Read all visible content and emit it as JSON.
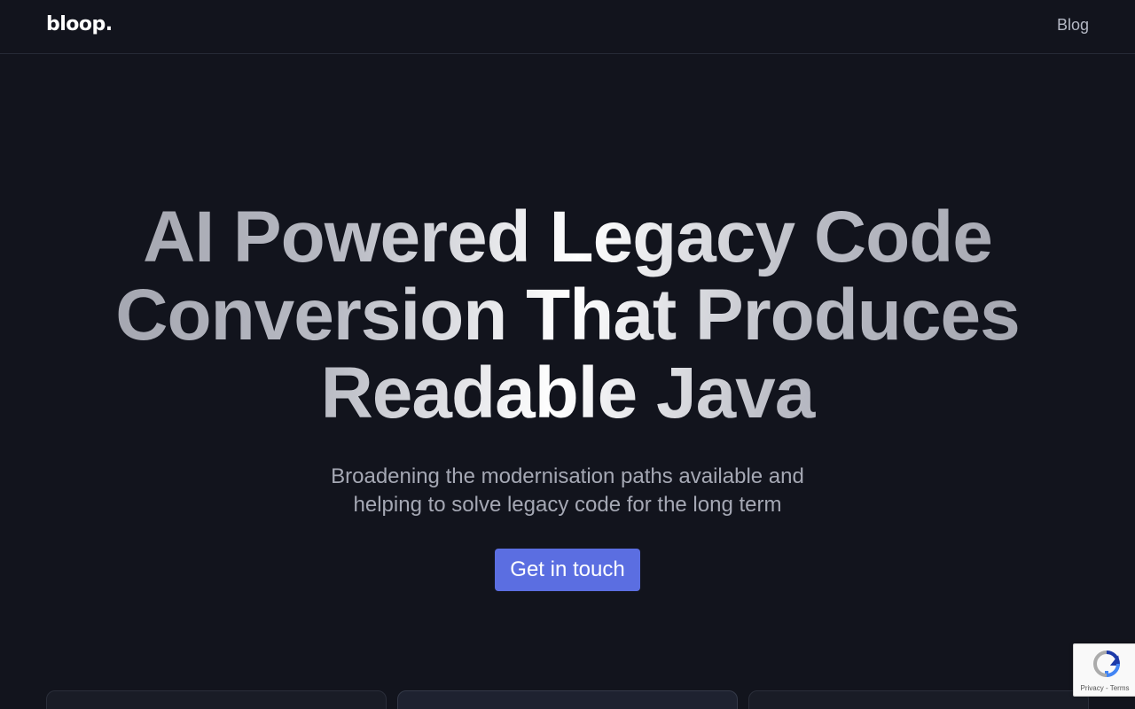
{
  "header": {
    "logo": "bloop.",
    "nav_blog": "Blog"
  },
  "hero": {
    "title_lines": [
      "AI Powered Legacy Code",
      "Conversion That Produces",
      "Readable Java"
    ],
    "subtitle_line1": "Broadening the modernisation paths available and",
    "subtitle_line2": "helping to solve legacy code for the long term",
    "cta_label": "Get in touch"
  },
  "recaptcha": {
    "links": "Privacy - Terms"
  },
  "colors": {
    "background": "#12141d",
    "accent": "#5b6ee1",
    "subtitle": "#a5a8b4"
  }
}
